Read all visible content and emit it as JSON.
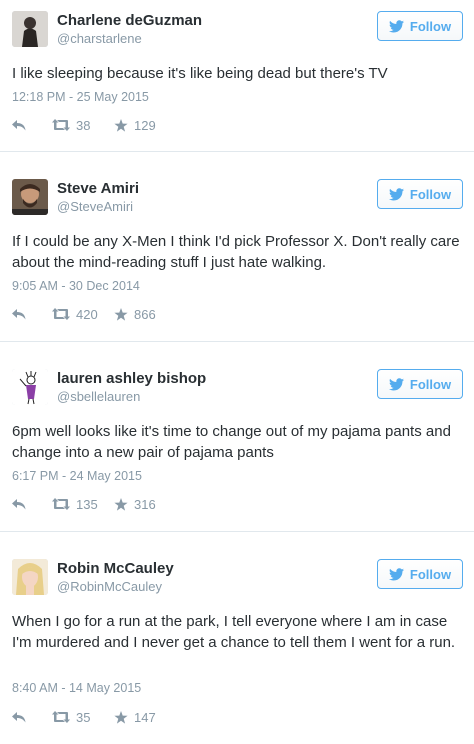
{
  "follow_label": "Follow",
  "accent_color": "#55acee",
  "tweets": [
    {
      "name": "Charlene deGuzman",
      "handle": "@charstarlene",
      "text": "I like sleeping because it's like being dead but there's TV",
      "timestamp": "12:18 PM - 25 May 2015",
      "retweets": "38",
      "favorites": "129"
    },
    {
      "name": "Steve Amiri",
      "handle": "@SteveAmiri",
      "text": "If I could be any X-Men I think I'd pick Professor X. Don't really care about the mind-reading stuff I just hate walking.",
      "timestamp": "9:05 AM - 30 Dec 2014",
      "retweets": "420",
      "favorites": "866"
    },
    {
      "name": "lauren ashley bishop",
      "handle": "@sbellelauren",
      "text": "6pm well looks like it's time to change out of my pajama pants and change into a new pair of pajama pants",
      "timestamp": "6:17 PM - 24 May 2015",
      "retweets": "135",
      "favorites": "316"
    },
    {
      "name": "Robin McCauley",
      "handle": "@RobinMcCauley",
      "text": "When I go for a run at the park, I tell everyone where I am in case I'm murdered and I never get a chance to tell them I went for a run.",
      "timestamp": "8:40 AM - 14 May 2015",
      "retweets": "35",
      "favorites": "147"
    }
  ]
}
